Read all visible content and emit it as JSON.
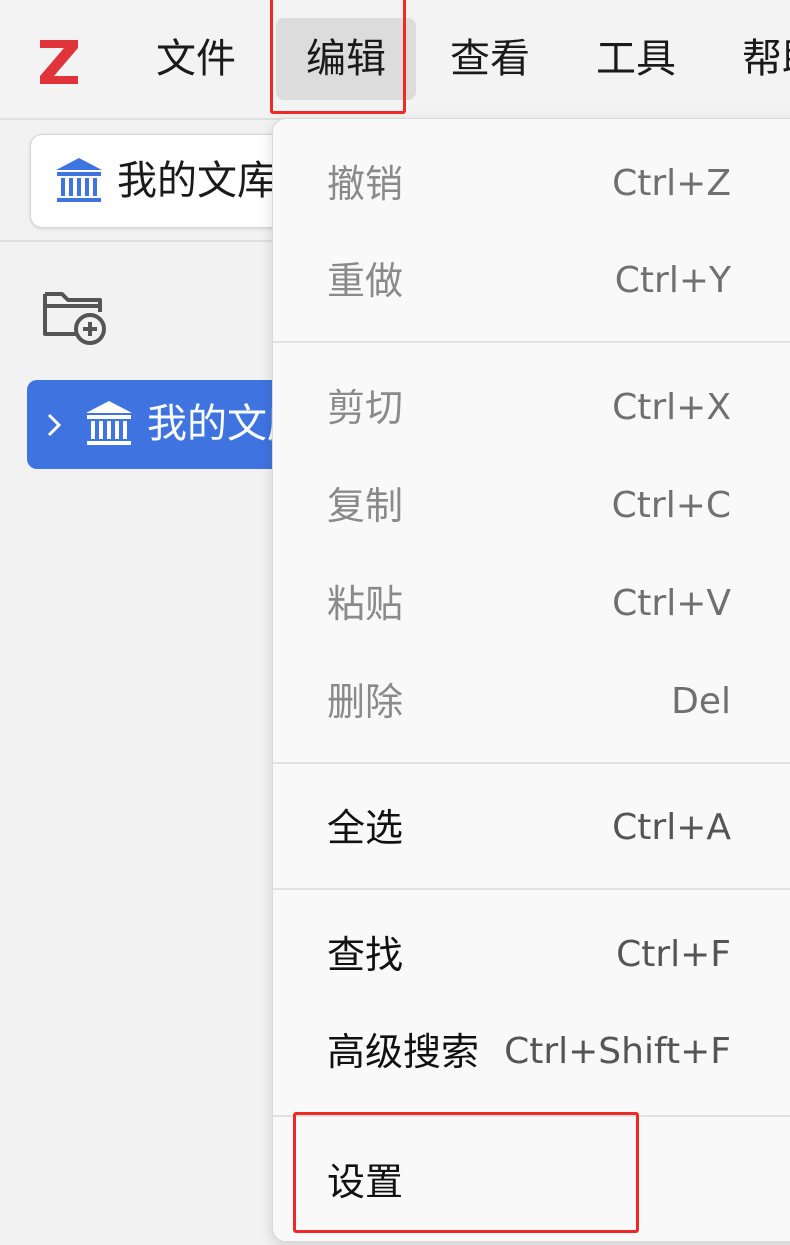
{
  "menubar": {
    "items": [
      {
        "label": "文件"
      },
      {
        "label": "编辑"
      },
      {
        "label": "查看"
      },
      {
        "label": "工具"
      },
      {
        "label": "帮助"
      }
    ]
  },
  "colors": {
    "logo_red": "#e0333a",
    "accent_blue": "#3f74e0",
    "highlight_red": "#ee2a24"
  },
  "library_selector": {
    "label": "我的文库",
    "icon": "library-icon"
  },
  "sidebar": {
    "new_collection_icon": "new-collection-icon",
    "tree": [
      {
        "label": "我的文库",
        "icon": "library-icon",
        "expander": "chevron-right-icon"
      }
    ]
  },
  "edit_menu": {
    "items": [
      {
        "label": "撤销",
        "shortcut": "Ctrl+Z",
        "enabled": false
      },
      {
        "label": "重做",
        "shortcut": "Ctrl+Y",
        "enabled": false
      },
      {
        "label": "剪切",
        "shortcut": "Ctrl+X",
        "enabled": false
      },
      {
        "label": "复制",
        "shortcut": "Ctrl+C",
        "enabled": false
      },
      {
        "label": "粘贴",
        "shortcut": "Ctrl+V",
        "enabled": false
      },
      {
        "label": "删除",
        "shortcut": "Del",
        "enabled": false
      },
      {
        "label": "全选",
        "shortcut": "Ctrl+A",
        "enabled": true
      },
      {
        "label": "查找",
        "shortcut": "Ctrl+F",
        "enabled": true
      },
      {
        "label": "高级搜索",
        "shortcut": "Ctrl+Shift+F",
        "enabled": true
      },
      {
        "label": "设置",
        "shortcut": "",
        "enabled": true
      }
    ]
  }
}
